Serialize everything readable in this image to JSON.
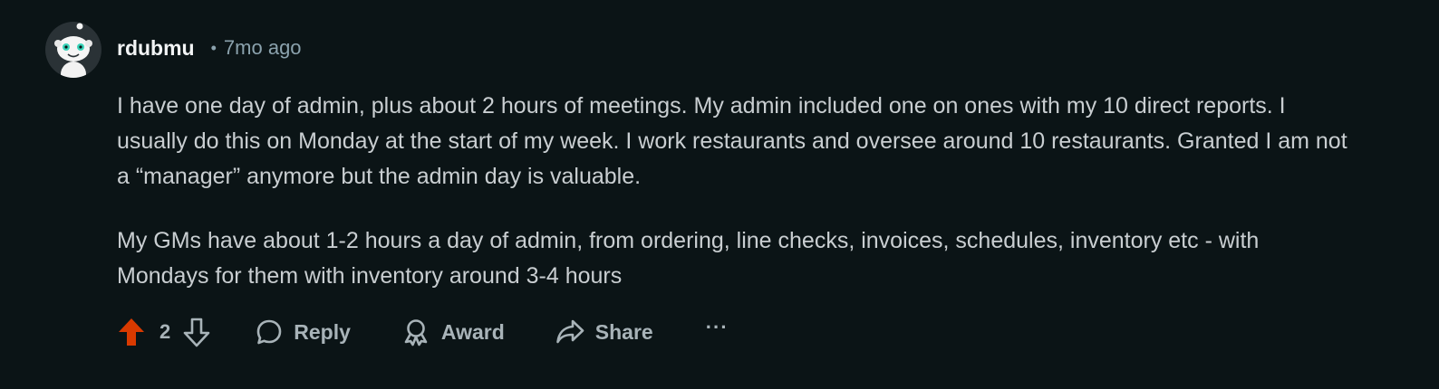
{
  "comment": {
    "author": "rdubmu",
    "separator": "•",
    "timestamp": "7mo ago",
    "paragraphs": [
      "I have one day of admin, plus about 2 hours of meetings. My admin included one on ones with my 10 direct reports. I usually do this on Monday at the start of my week. I work restaurants and oversee around 10 restaurants. Granted I am not a “manager” anymore but the admin day is valuable.",
      "My GMs have about 1-2 hours a day of admin, from ordering, line checks, invoices, schedules, inventory etc - with Mondays for them with inventory around 3-4 hours"
    ],
    "score": "2",
    "upvoted": true
  },
  "actions": {
    "reply_label": "Reply",
    "award_label": "Award",
    "share_label": "Share",
    "more_label": "···"
  },
  "icons": {
    "avatar": "snoo-avatar-icon",
    "upvote": "upvote-arrow-icon",
    "downvote": "downvote-arrow-icon",
    "reply": "speech-bubble-icon",
    "award": "award-ribbon-icon",
    "share": "share-arrow-icon"
  },
  "colors": {
    "background": "#0b1416",
    "upvote_active": "#d93a00",
    "muted_text": "#8ba2ad",
    "body_text": "#c9ced1"
  }
}
